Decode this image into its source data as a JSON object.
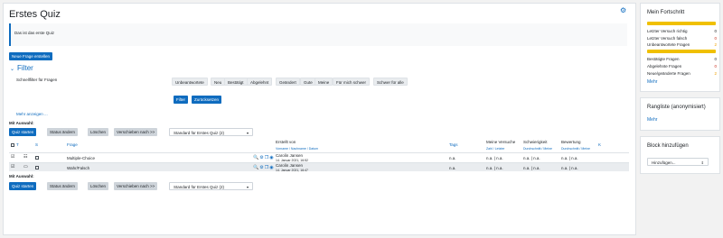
{
  "page": {
    "title": "Erstes Quiz",
    "intro_text": "Das ist das erste Quiz",
    "new_question_button": "Neue Frage erstellen",
    "filter_heading": "Filter",
    "quick_filter_label": "Schnellfilter für Fragen",
    "filter_buttons": [
      "Unbeantwortete",
      "Neu",
      "Bestätigt",
      "Abgelehnt",
      "Geändert",
      "Gute",
      "Meine",
      "Für mich schwer",
      "Schwer für alle"
    ],
    "filter_button": "Filter",
    "reset_button": "Zurücksetzen",
    "show_more": "Mehr anzeigen ..."
  },
  "bulk": {
    "label": "Mit Auswahl:",
    "start_quiz": "Quiz starten",
    "change_status": "Status ändern",
    "delete": "Löschen",
    "move_to": "Verschieben nach >>",
    "category_select": "Standard für Erstes Quiz (2)"
  },
  "table": {
    "col_t": "T",
    "col_s": "S",
    "col_question": "Frage",
    "col_created_by": "Erstellt von",
    "col_created_sub": "Vorname / Nachname / Datum",
    "col_tags": "Tags",
    "col_my_attempts": "Meine Versuche",
    "col_my_attempts_sub": "Zahl / Letzter",
    "col_difficulty": "Schwierigkeit",
    "col_difficulty_sub": "Durchschnitt / Meine",
    "col_rating": "Bewertung",
    "col_rating_sub": "Durchschnitt / Meine",
    "col_k": "K",
    "rows": [
      {
        "question": "Multiple-Choice",
        "author": "Carolin Jansen",
        "date": "14. Januar 2021, 16:52",
        "tags": "n.a.",
        "attempts": "n.a. | n.a.",
        "difficulty": "n.a. | n.a.",
        "rating": "n.a. | n.a."
      },
      {
        "question": "Wahr/Falsch",
        "author": "Carolin Jansen",
        "date": "14. Januar 2021, 16:47",
        "tags": "n.a.",
        "attempts": "n.a. | n.a.",
        "difficulty": "n.a. | n.a.",
        "rating": "n.a. | n.a."
      }
    ]
  },
  "sidebar": {
    "progress_title": "Mein Fortschritt",
    "progress_stats": [
      {
        "label": "Letzter Versuch richtig",
        "value": "0",
        "color": "#1d2125"
      },
      {
        "label": "Letzter Versuch falsch",
        "value": "0",
        "color": "#ca3120"
      },
      {
        "label": "Unbeantwortete Fragen",
        "value": "2",
        "color": "#f0a000"
      }
    ],
    "review_stats": [
      {
        "label": "Bestätigte Fragen",
        "value": "0",
        "color": "#1d2125"
      },
      {
        "label": "Abgelehnte Fragen",
        "value": "0",
        "color": "#ca3120"
      },
      {
        "label": "Neue/geänderte Fragen",
        "value": "2",
        "color": "#f0a000"
      }
    ],
    "more_1": "Mehr",
    "ranking_title": "Rangliste (anonymisiert)",
    "more_2": "Mehr",
    "add_block_title": "Block hinzufügen",
    "add_block_select": "Hinzufügen..."
  }
}
